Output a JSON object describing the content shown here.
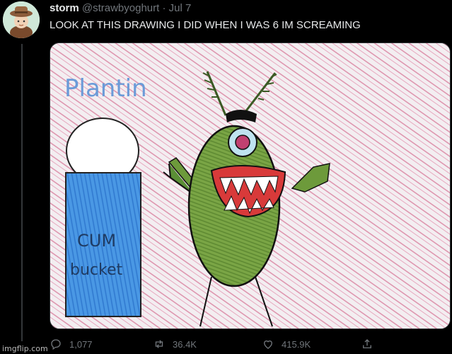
{
  "tweet": {
    "author_name": "storm",
    "author_handle": "@strawbyoghurt",
    "separator": "·",
    "date": "Jul 7",
    "text": "LOOK AT THIS DRAWING I DID WHEN I WAS 6 IM SCREAMING",
    "more_icon": "more-horizontal-icon"
  },
  "media": {
    "drawing_word_top": "Plantin",
    "bucket_text_line1": "CUM",
    "bucket_text_line2": "bucket"
  },
  "actions": {
    "replies": "1,077",
    "retweets": "36.4K",
    "likes": "415.9K",
    "reply_icon": "reply-icon",
    "retweet_icon": "retweet-icon",
    "like_icon": "heart-icon",
    "share_icon": "share-icon"
  },
  "watermark": "imgflip.com",
  "colors": {
    "background": "#000000",
    "text_primary": "#e7e9ea",
    "text_secondary": "#71767b",
    "crayon_pink": "#d9789a",
    "plankton_green": "#6f9a3a",
    "bucket_blue": "#3f8fe0"
  }
}
